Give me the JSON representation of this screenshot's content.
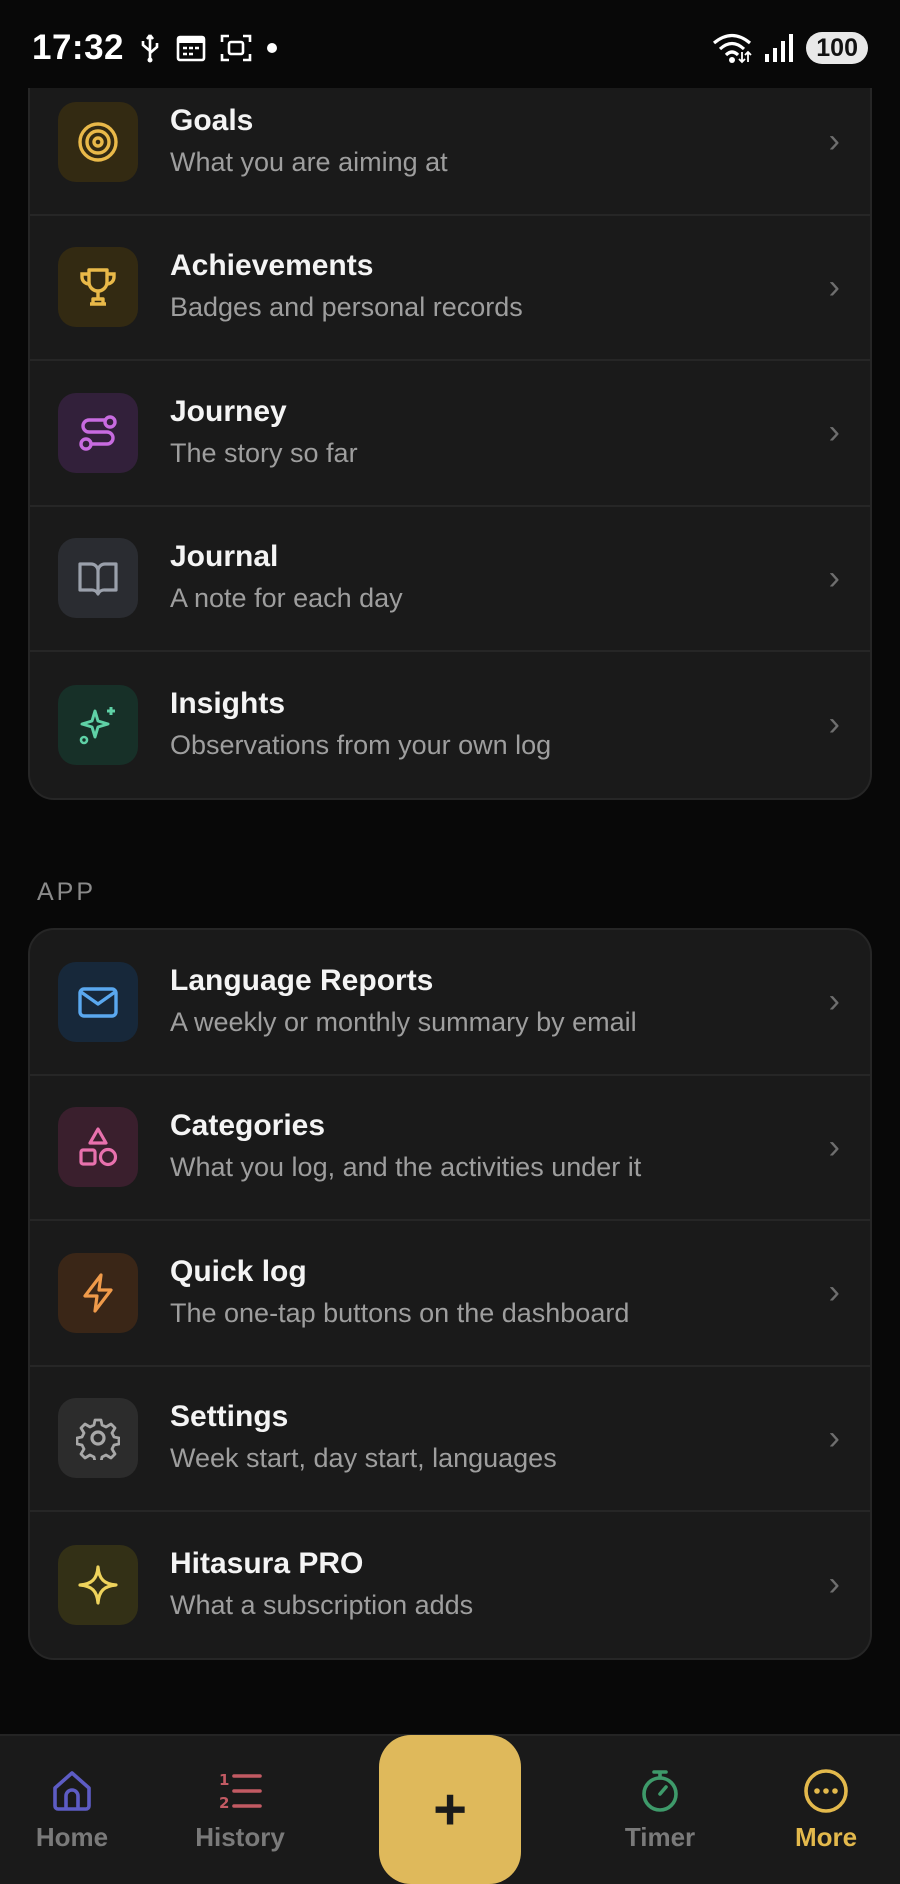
{
  "status_bar": {
    "time": "17:32",
    "battery": "100",
    "icons": [
      "usb-icon",
      "calendar-icon",
      "screenshot-icon",
      "dot-icon",
      "wifi-icon",
      "signal-icon"
    ]
  },
  "top_section": {
    "items": [
      {
        "title": "Goals",
        "subtitle": "What you are aiming at",
        "icon": "target-icon",
        "color": "#e9b949",
        "tile": "#332a12"
      },
      {
        "title": "Achievements",
        "subtitle": "Badges and personal records",
        "icon": "trophy-icon",
        "color": "#e9b949",
        "tile": "#332a12"
      },
      {
        "title": "Journey",
        "subtitle": "The story so far",
        "icon": "route-icon",
        "color": "#c86be0",
        "tile": "#32203a"
      },
      {
        "title": "Journal",
        "subtitle": "A note for each day",
        "icon": "book-icon",
        "color": "#9aa0ab",
        "tile": "#2a2c31"
      },
      {
        "title": "Insights",
        "subtitle": "Observations from your own log",
        "icon": "sparkle-icon",
        "color": "#5fd1a6",
        "tile": "#173028"
      }
    ]
  },
  "app_section": {
    "label": "APP",
    "items": [
      {
        "title": "Language Reports",
        "subtitle": "A weekly or monthly summary by email",
        "icon": "mail-icon",
        "color": "#5aa8ef",
        "tile": "#17283a"
      },
      {
        "title": "Categories",
        "subtitle": "What you log, and the activities under it",
        "icon": "shapes-icon",
        "color": "#e871ad",
        "tile": "#3a1f2d"
      },
      {
        "title": "Quick log",
        "subtitle": "The one-tap buttons on the dashboard",
        "icon": "bolt-icon",
        "color": "#ef9a4a",
        "tile": "#3a2617"
      },
      {
        "title": "Settings",
        "subtitle": "Week start, day start, languages",
        "icon": "gear-icon",
        "color": "#a8a8a8",
        "tile": "#2c2c2c"
      },
      {
        "title": "Hitasura PRO",
        "subtitle": "What a subscription adds",
        "icon": "star-sparkle-icon",
        "color": "#eed35c",
        "tile": "#333016"
      }
    ]
  },
  "bottom_nav": {
    "home": "Home",
    "history": "History",
    "add": "+",
    "timer": "Timer",
    "more": "More",
    "active": "more",
    "colors": {
      "home": "#5d5cc4",
      "history": "#c25a63",
      "timer": "#3e9a6a",
      "more": "#e3b94c"
    }
  }
}
